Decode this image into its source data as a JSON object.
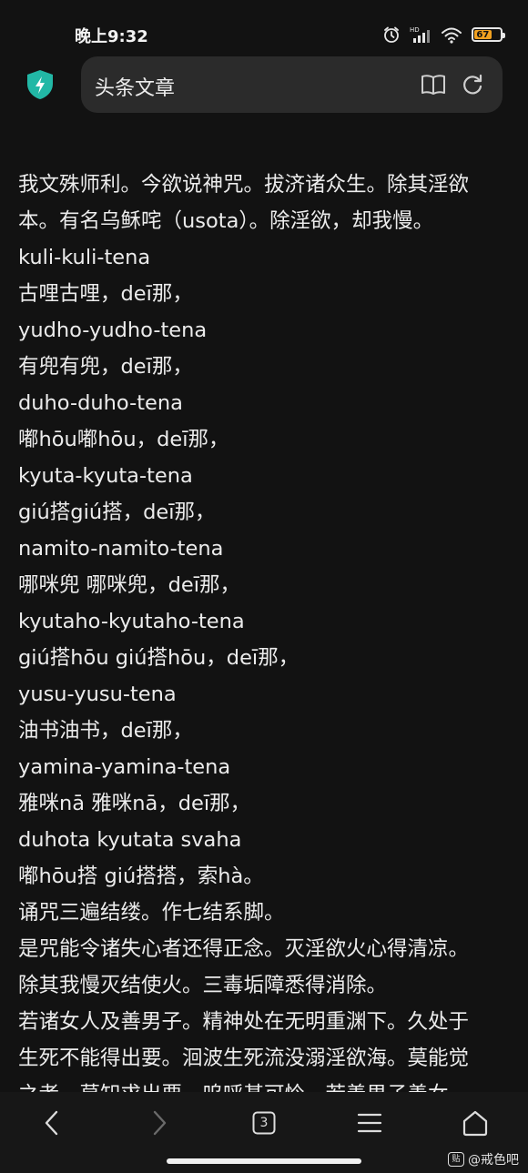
{
  "status_bar": {
    "time": "晚上9:32",
    "battery_level": "67",
    "network": "HD"
  },
  "address_bar": {
    "title": "头条文章"
  },
  "article": {
    "lines": [
      "我文殊师利。今欲说神咒。拔济诸众生。除其淫欲",
      "本。有名乌稣咤（usota）。除淫欲，却我慢。",
      "kuli-kuli-tena",
      "古哩古哩，deī那，",
      "yudho-yudho-tena",
      "有兜有兜，deī那，",
      "duho-duho-tena",
      "嘟hōu嘟hōu，deī那，",
      "kyuta-kyuta-tena",
      "giú搭giú搭，deī那，",
      "namito-namito-tena",
      "哪咪兜 哪咪兜，deī那，",
      "kyutaho-kyutaho-tena",
      "giú搭hōu giú搭hōu，deī那，",
      "yusu-yusu-tena",
      "油书油书，deī那，",
      "yamina-yamina-tena",
      "雅咪nā 雅咪nā，deī那，",
      "duhota kyutata svaha",
      "嘟hōu搭 giú搭搭，索hà。",
      "诵咒三遍结缕。作七结系脚。",
      "是咒能令诸失心者还得正念。灭淫欲火心得清凉。",
      "除其我慢灭结使火。三毒垢障悉得消除。",
      "若诸女人及善男子。精神处在无明重渊下。久处于",
      "生死不能得出要。洄波生死流没溺淫欲海。莫能觉",
      "之者。莫知求出要。呜呼甚可怜。若善男子善女"
    ]
  },
  "bottom_nav": {
    "back_label": "‹",
    "forward_label": "›",
    "tabs_count": "3"
  },
  "watermark": {
    "text": "@戒色吧",
    "logo_text": "贴"
  }
}
